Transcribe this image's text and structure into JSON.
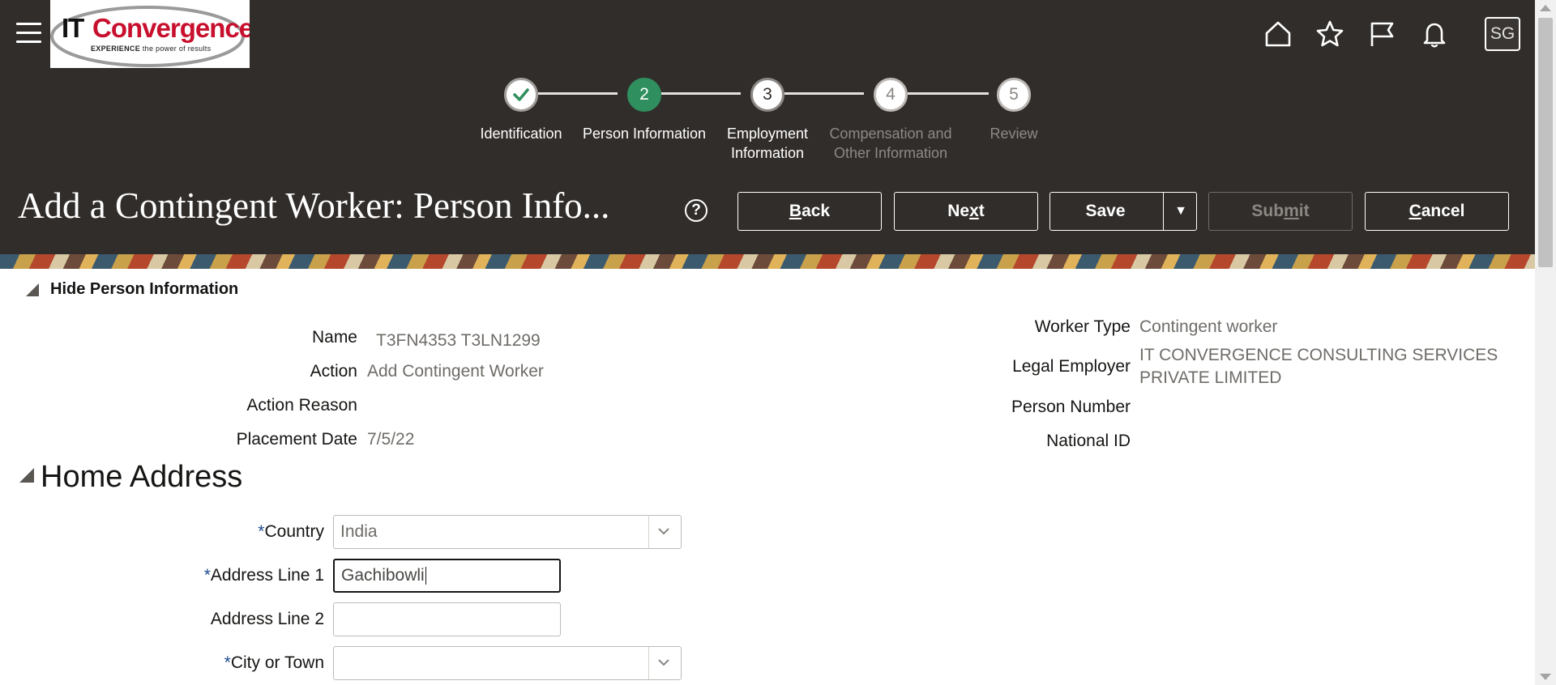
{
  "header": {
    "logo": {
      "brand_it": "IT",
      "brand_name": "Convergence",
      "tagline_bold": "EXPERIENCE",
      "tagline": " the power of results"
    },
    "icons": [
      "menu-icon",
      "home-icon",
      "star-icon",
      "flag-icon",
      "bell-icon"
    ],
    "avatar_initials": "SG"
  },
  "train": {
    "steps": [
      {
        "number": "",
        "label": "Identification",
        "state": "done"
      },
      {
        "number": "2",
        "label": "Person Information",
        "state": "current"
      },
      {
        "number": "3",
        "label": "Employment Information",
        "state": "next"
      },
      {
        "number": "4",
        "label": "Compensation and Other Information",
        "state": "future"
      },
      {
        "number": "5",
        "label": "Review",
        "state": "future"
      }
    ]
  },
  "page": {
    "title": "Add a Contingent Worker: Person Info...",
    "help_icon": "?"
  },
  "toolbar": {
    "back": {
      "prefix": "",
      "accel": "B",
      "rest": "ack"
    },
    "next": {
      "prefix": "Ne",
      "accel": "x",
      "rest": "t"
    },
    "save": "Save",
    "save_dropdown_icon": "▼",
    "submit": {
      "prefix": "Sub",
      "accel": "m",
      "rest": "it"
    },
    "cancel": {
      "prefix": "",
      "accel": "C",
      "rest": "ancel"
    }
  },
  "person_section": {
    "toggle_label": "Hide Person Information",
    "left": [
      {
        "label": "Name",
        "value": "T3FN4353 T3LN1299"
      },
      {
        "label": "Action",
        "value": "Add Contingent Worker"
      },
      {
        "label": "Action Reason",
        "value": ""
      },
      {
        "label": "Placement Date",
        "value": "7/5/22"
      }
    ],
    "right": [
      {
        "label": "Worker Type",
        "value": "Contingent worker"
      },
      {
        "label": "Legal Employer",
        "value": "IT CONVERGENCE CONSULTING SERVICES",
        "value_line2": "PRIVATE LIMITED"
      },
      {
        "label": "Person Number",
        "value": ""
      },
      {
        "label": "National ID",
        "value": ""
      }
    ]
  },
  "home_address": {
    "title": "Home Address",
    "required_mark": "*",
    "country": {
      "label": "Country",
      "value": "India"
    },
    "address_line1": {
      "label": "Address Line 1",
      "value": "Gachibowli"
    },
    "address_line2": {
      "label": "Address Line 2",
      "value": ""
    },
    "city": {
      "label": "City or Town",
      "value": ""
    }
  }
}
